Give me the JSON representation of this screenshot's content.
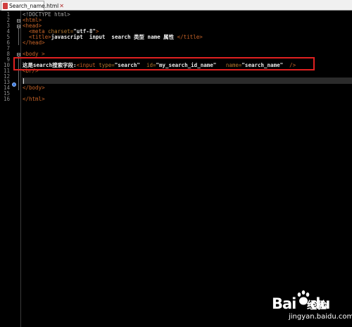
{
  "tab": {
    "label": "Search_name.html"
  },
  "lines": [
    {
      "n": "1"
    },
    {
      "n": "2"
    },
    {
      "n": "3"
    },
    {
      "n": "4"
    },
    {
      "n": "5"
    },
    {
      "n": "6"
    },
    {
      "n": "7"
    },
    {
      "n": "8"
    },
    {
      "n": "9"
    },
    {
      "n": "10"
    },
    {
      "n": "11"
    },
    {
      "n": "12"
    },
    {
      "n": "13"
    },
    {
      "n": "14"
    },
    {
      "n": "15"
    },
    {
      "n": "16"
    }
  ],
  "code": {
    "l1": "<!DOCTYPE html>",
    "l2": "<html>",
    "l3": "<head>",
    "l4_tag": "<meta ",
    "l4_attr": "charset=",
    "l4_str": "\"utf-8\"",
    "l4_end": ">",
    "l5_open": "<title>",
    "l5_text": "javascript  input  search 类型 name 属性 ",
    "l5_close": "</title>",
    "l6": "</head>",
    "l8": "<body >",
    "l10_text": "这是search搜索字段:",
    "l10_tag": "<input ",
    "l10_a1": "type=",
    "l10_v1": "\"search\"",
    "l10_a2": "  id=",
    "l10_v2": "\"my_search_id_name\"",
    "l10_a3": "   name=",
    "l10_v3": "\"search_name\"",
    "l10_end": "  />",
    "l11": "<br/>",
    "l14": "</body>",
    "l16": "</html>"
  },
  "watermark": {
    "brand": "Bai",
    "brand2": "du",
    "jingyan": "经验",
    "site": "jingyan.baidu.com"
  },
  "colors": {
    "tag": "#c86428",
    "highlight_box": "#e02020",
    "background": "#000000"
  }
}
